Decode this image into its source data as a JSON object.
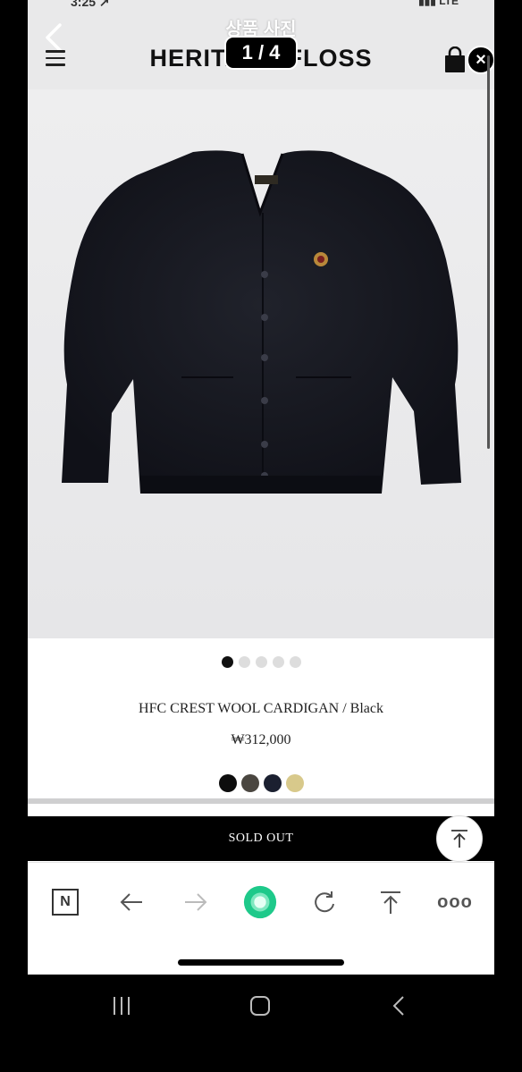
{
  "status_bar": {
    "time": "3:25 ↗",
    "right": "▮▮▮ LTE"
  },
  "viewer": {
    "title": "상품 사진",
    "counter": "1 / 4",
    "close_glyph": "×"
  },
  "header": {
    "brand": "HERITAGE FLOSS"
  },
  "gallery": {
    "total_dots": 5,
    "active_index": 0
  },
  "product": {
    "name": "HFC CREST WOOL CARDIGAN / Black",
    "price": "₩312,000",
    "swatches": [
      "#0d0d0d",
      "#4a4640",
      "#1b2030",
      "#d8c98b"
    ]
  },
  "sold_out_label": "SOLD OUT",
  "browser_toolbar": {
    "buttons": [
      "naver-logo",
      "back-arrow",
      "forward-arrow",
      "home-circle",
      "refresh",
      "share-up",
      "more-dots"
    ],
    "naver_letter": "N",
    "more_glyph": "ooo"
  },
  "system_nav": [
    "recents",
    "home",
    "back"
  ],
  "colors": {
    "sold_out_bg": "#000000",
    "accent_green": "#1ec98a",
    "page_bg": "#e9e9ea"
  }
}
